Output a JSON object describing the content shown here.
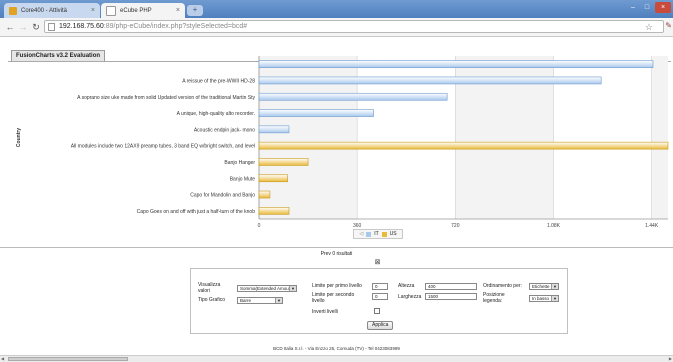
{
  "browser": {
    "tabs": [
      {
        "label": "Core400 - Attività",
        "favicon_color": "#e2a323"
      },
      {
        "label": "eCube PHP",
        "favicon_color": "#ffffff"
      }
    ],
    "url_host": "192.168.75.60",
    "url_path": ":89/php-eCube/index.php?styleSelected=bcd#"
  },
  "chart_data": {
    "type": "bar",
    "orientation": "horizontal",
    "title": "FusionCharts v3.2 Evaluation",
    "ylabel": "Country",
    "xlim": [
      0,
      1500
    ],
    "xticks": [
      "0",
      "360",
      "720",
      "1.08K",
      "1.44K"
    ],
    "grid": true,
    "legend_position": "bottom-center",
    "series": [
      {
        "name": "IT",
        "color": "#a9c8ec"
      },
      {
        "name": "US",
        "color": "#e9b93a"
      }
    ],
    "categories": [
      {
        "label": "",
        "value": 1445,
        "series": "IT"
      },
      {
        "label": "A reissue of the pre-WWII HD-28",
        "value": 1255,
        "series": "IT"
      },
      {
        "label": "A soprano size uke made from solid Updated version of the traditional Martin Sty",
        "value": 690,
        "series": "IT"
      },
      {
        "label": "A unique, high-quality alto recorder.",
        "value": 420,
        "series": "IT"
      },
      {
        "label": "Acoustic endpin jack- mono",
        "value": 110,
        "series": "IT"
      },
      {
        "label": "All modules include two 12AX9 preamp tubes, 3 band EQ w/bright switch, and level",
        "value": 1500,
        "series": "US"
      },
      {
        "label": "Banjo Hanger",
        "value": 180,
        "series": "US"
      },
      {
        "label": "Banjo Mute",
        "value": 105,
        "series": "US"
      },
      {
        "label": "Capo for Mandolin and Banjo",
        "value": 40,
        "series": "US"
      },
      {
        "label": "Capo Goes on and off with just a half-turn of the knob",
        "value": 110,
        "series": "US"
      }
    ]
  },
  "results_text": "Prev 0 risultati",
  "form": {
    "visualizza_label_1": "Visualizza",
    "visualizza_label_2": "valori",
    "visualizza_value": "Somma(Extended Amount)",
    "tipo_grafico_label": "Tipo Grafico",
    "tipo_grafico_value": "Barre",
    "limite_primo_label_1": "Limite per primo livello",
    "limite_primo_value": "0",
    "limite_secondo_label_1": "Limite per secondo",
    "limite_secondo_label_2": "livello",
    "limite_secondo_value": "0",
    "inverti_label": "Inverti livelli",
    "altezza_label": "Altezza",
    "altezza_value": "400",
    "larghezza_label": "Larghezza",
    "larghezza_value": "1500",
    "ordinamento_label": "Ordinamento per:",
    "ordinamento_value": "Etichette",
    "posizione_label_1": "Posizione",
    "posizione_label_2": "legenda:",
    "posizione_value": "In basso",
    "applica_label": "Applica"
  },
  "footer_text": "BCD Italia S.r.l. - Via Enzzo 25, Cornuda (TV) - Tel 0423083999"
}
